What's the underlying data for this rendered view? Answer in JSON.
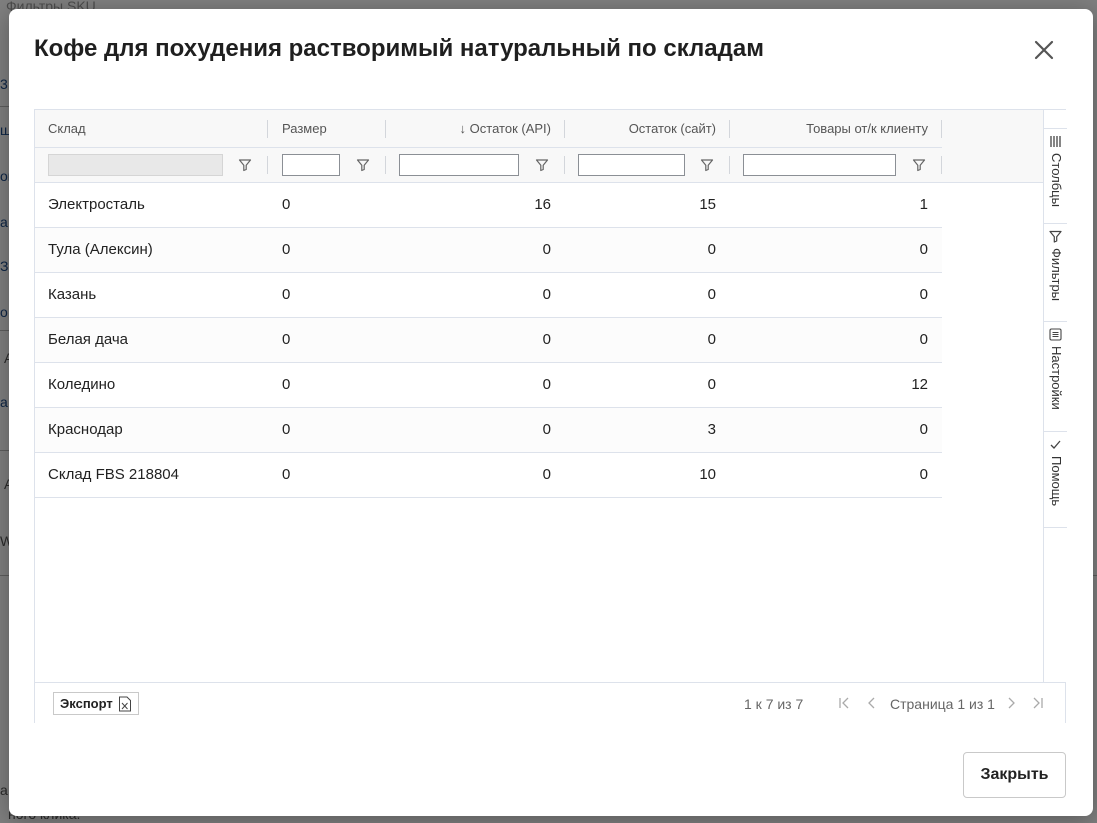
{
  "background": {
    "fragments": [
      "Фильтры SKU",
      "3",
      "ш",
      "ов",
      "а",
      "З",
      "о",
      "А",
      "а",
      "А",
      "W",
      "а",
      "ного клика."
    ]
  },
  "modal": {
    "title": "Кофе для похудения растворимый натуральный по складам",
    "close_button_label": "Закрыть"
  },
  "grid": {
    "columns": [
      {
        "label": "Склад"
      },
      {
        "label": "Размер"
      },
      {
        "label": "Остаток (API)",
        "sort_indicator": "↓"
      },
      {
        "label": "Остаток (сайт)"
      },
      {
        "label": "Товары от/к клиенту"
      }
    ],
    "rows": [
      {
        "warehouse": "Электросталь",
        "size": "0",
        "stock_api": "16",
        "stock_site": "15",
        "to_from_client": "1"
      },
      {
        "warehouse": "Тула (Алексин)",
        "size": "0",
        "stock_api": "0",
        "stock_site": "0",
        "to_from_client": "0"
      },
      {
        "warehouse": "Казань",
        "size": "0",
        "stock_api": "0",
        "stock_site": "0",
        "to_from_client": "0"
      },
      {
        "warehouse": "Белая дача",
        "size": "0",
        "stock_api": "0",
        "stock_site": "0",
        "to_from_client": "0"
      },
      {
        "warehouse": "Коледино",
        "size": "0",
        "stock_api": "0",
        "stock_site": "0",
        "to_from_client": "12"
      },
      {
        "warehouse": "Краснодар",
        "size": "0",
        "stock_api": "0",
        "stock_site": "3",
        "to_from_client": "0"
      },
      {
        "warehouse": "Склад FBS 218804",
        "size": "0",
        "stock_api": "0",
        "stock_site": "10",
        "to_from_client": "0"
      }
    ],
    "side_panel": [
      "Столбцы",
      "Фильтры",
      "Настройки",
      "Помощь"
    ],
    "footer": {
      "export_label": "Экспорт",
      "row_summary": "1 к 7 из 7",
      "page_summary": "Страница 1 из 1"
    }
  },
  "colors": {
    "border": "#dde2eb",
    "header_bg": "#f8f8f8",
    "text": "#222222",
    "muted_text": "#666666"
  }
}
